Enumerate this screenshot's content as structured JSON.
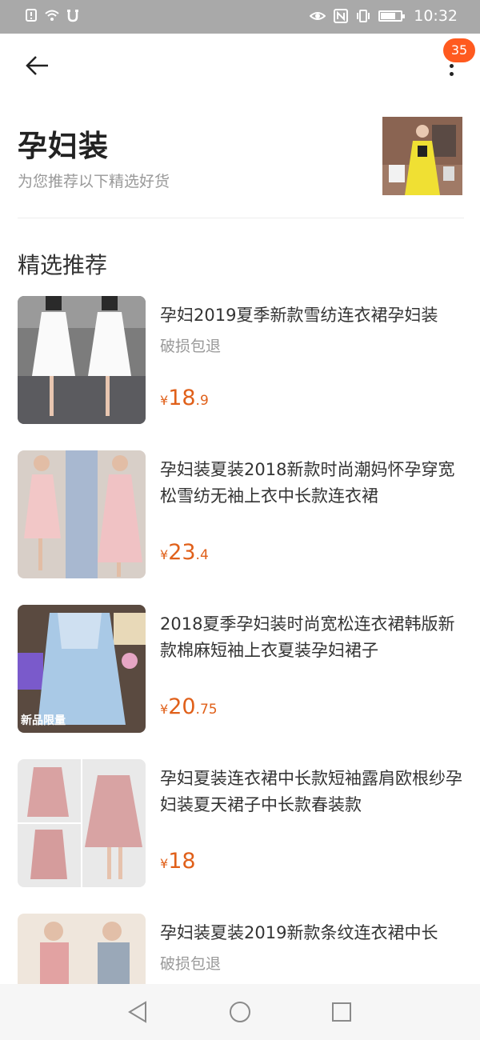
{
  "status": {
    "time": "10:32",
    "left_icons": [
      "alert-icon",
      "wifi-icon",
      "notification-icon"
    ],
    "right_icons": [
      "eye-icon",
      "nfc-icon",
      "vibrate-icon",
      "battery-icon"
    ],
    "battery_level": 0.75
  },
  "header": {
    "back_icon": "back-arrow-icon",
    "more_icon": "more-vertical-icon",
    "badge_count": "35"
  },
  "hero": {
    "title": "孕妇装",
    "subtitle": "为您推荐以下精选好货"
  },
  "section_title": "精选推荐",
  "colors": {
    "price": "#e0601a",
    "badge": "#ff5a1f",
    "statusbar": "#a9a9a9"
  },
  "products": [
    {
      "title": "孕妇2019夏季新款雪纺连衣裙孕妇装",
      "tag": "破损包退",
      "price_currency": "¥",
      "price_int": "18",
      "price_dec": ".9"
    },
    {
      "title": "孕妇装夏装2018新款时尚潮妈怀孕穿宽松雪纺无袖上衣中长款连衣裙",
      "tag": "",
      "price_currency": "¥",
      "price_int": "23",
      "price_dec": ".4"
    },
    {
      "title": "2018夏季孕妇装时尚宽松连衣裙韩版新款棉麻短袖上衣夏装孕妇裙子",
      "tag": "",
      "price_currency": "¥",
      "price_int": "20",
      "price_dec": ".75",
      "image_label": "新品限量"
    },
    {
      "title": "孕妇夏装连衣裙中长款短袖露肩欧根纱孕妇装夏天裙子中长款春装款",
      "tag": "",
      "price_currency": "¥",
      "price_int": "18",
      "price_dec": ""
    },
    {
      "title": "孕妇装夏装2019新款条纹连衣裙中长",
      "tag": "破损包退",
      "price_currency": "¥",
      "price_int": "",
      "price_dec": ""
    }
  ],
  "nav": {
    "back_icon": "nav-back-triangle-icon",
    "home_icon": "nav-home-circle-icon",
    "recents_icon": "nav-recents-square-icon"
  }
}
